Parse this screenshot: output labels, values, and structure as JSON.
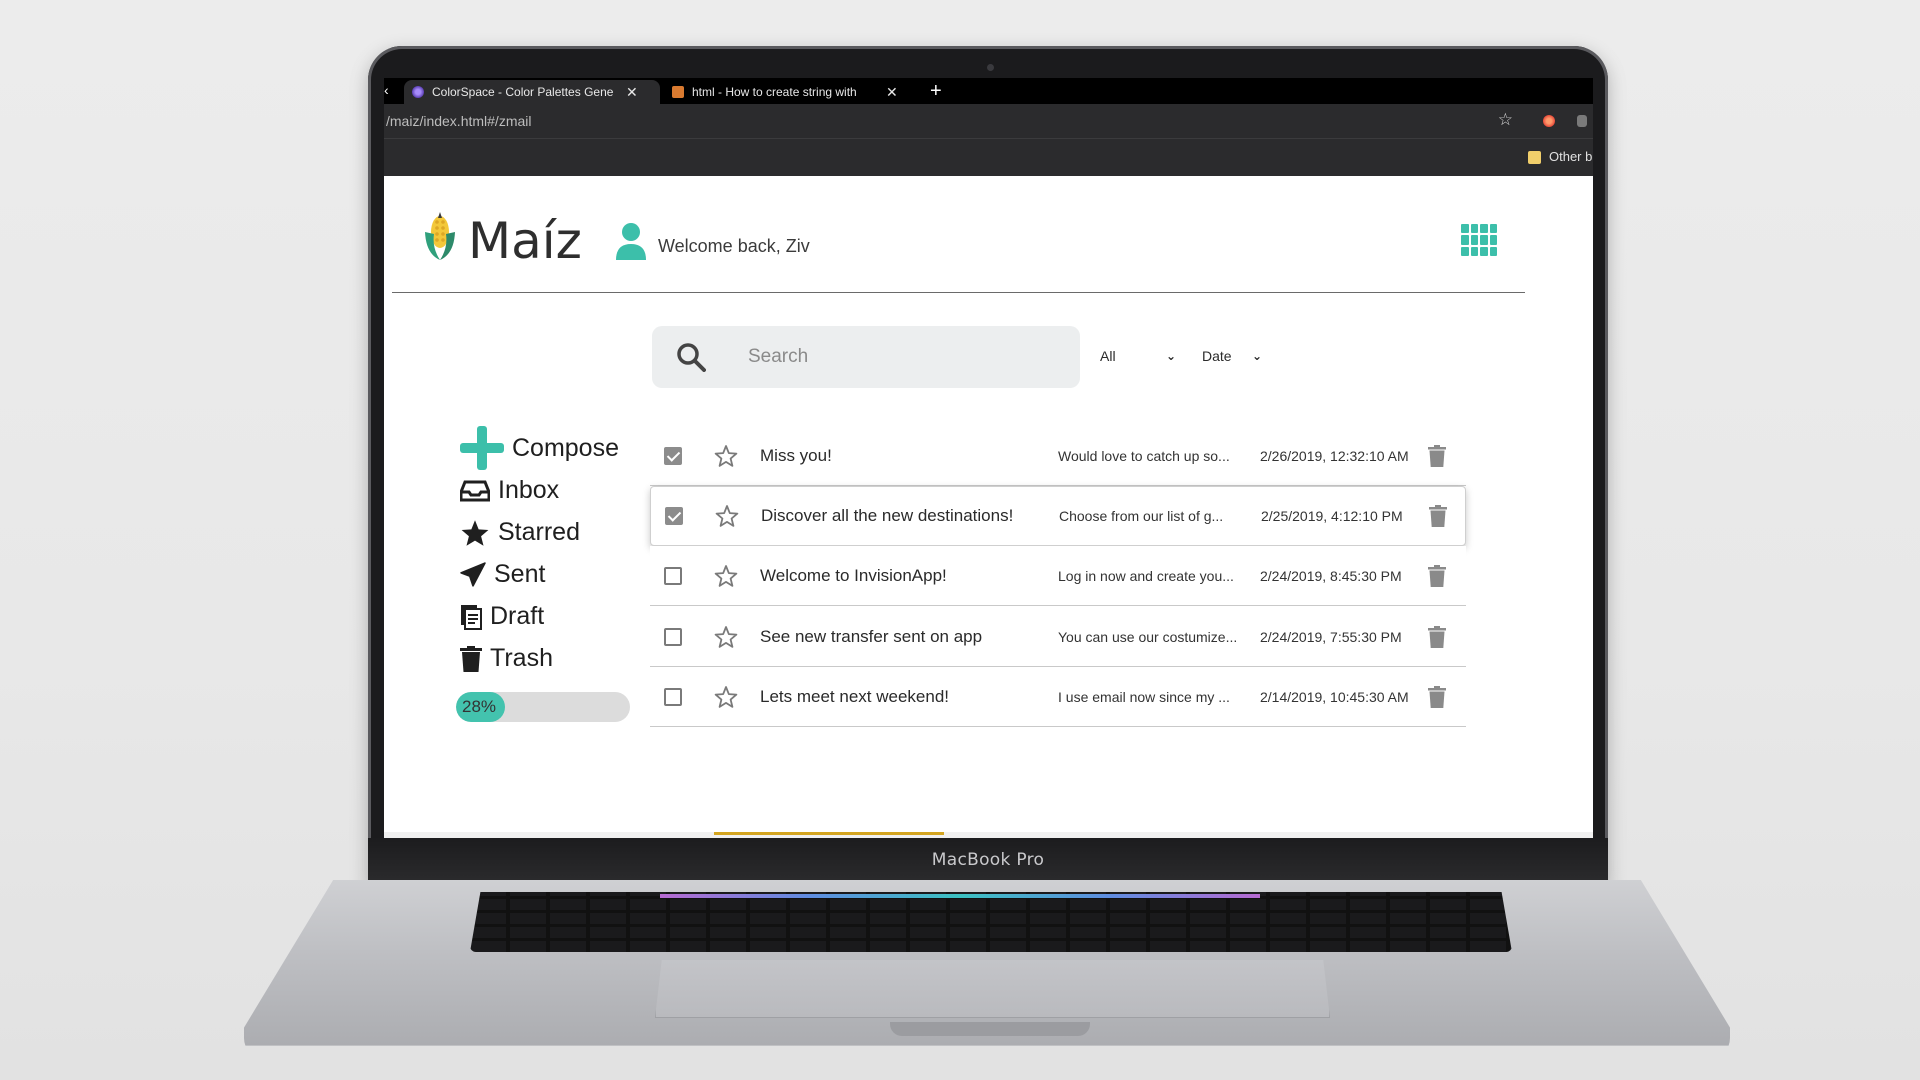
{
  "browser": {
    "tabs": [
      {
        "title": "ColorSpace - Color Palettes Gene",
        "close": "✕"
      },
      {
        "title": "html - How to create string with",
        "close": "✕"
      }
    ],
    "new_tab": "+",
    "url": "/maiz/index.html#/zmail",
    "bookmark_label": "Other b"
  },
  "device_label": "MacBook Pro",
  "app": {
    "logo_text": "Maíz",
    "welcome_text": "Welcome back, Ziv",
    "accent_color": "#3cbfaa"
  },
  "search": {
    "placeholder": "Search",
    "filter_all": "All",
    "filter_date": "Date"
  },
  "sidebar": {
    "items": [
      {
        "label": "Compose",
        "icon": "plus-icon"
      },
      {
        "label": "Inbox",
        "icon": "inbox-icon"
      },
      {
        "label": "Starred",
        "icon": "star-icon"
      },
      {
        "label": "Sent",
        "icon": "paper-plane-icon"
      },
      {
        "label": "Draft",
        "icon": "draft-icon"
      },
      {
        "label": "Trash",
        "icon": "trash-icon"
      }
    ],
    "storage_used_label": "28%",
    "storage_used_percent": 28
  },
  "emails": [
    {
      "checked": true,
      "subject": "Miss you!",
      "preview": "Would love to catch up so...",
      "date": "2/26/2019, 12:32:10 AM"
    },
    {
      "checked": true,
      "subject": "Discover all the new destinations!",
      "preview": "Choose from our list of g...",
      "date": "2/25/2019, 4:12:10 PM"
    },
    {
      "checked": false,
      "subject": "Welcome to InvisionApp!",
      "preview": "Log in now and create you...",
      "date": "2/24/2019, 8:45:30 PM"
    },
    {
      "checked": false,
      "subject": "See new transfer sent on app",
      "preview": "You can use our costumize...",
      "date": "2/24/2019, 7:55:30 PM"
    },
    {
      "checked": false,
      "subject": "Lets meet next weekend!",
      "preview": "I use email now since my ...",
      "date": "2/14/2019, 10:45:30 AM"
    }
  ]
}
